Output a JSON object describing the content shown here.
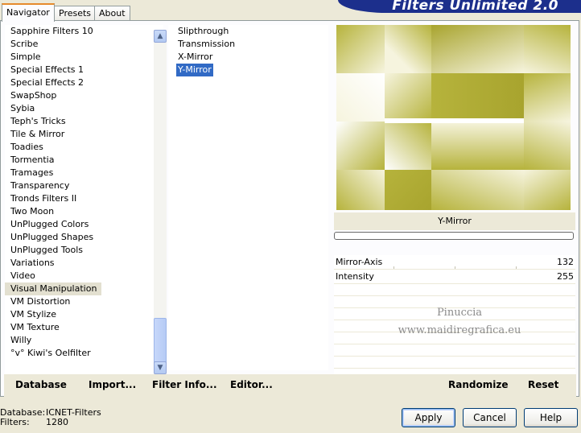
{
  "tabs": [
    "Navigator",
    "Presets",
    "About"
  ],
  "banner": "Filters Unlimited 2.0",
  "categories": {
    "items": [
      "Sapphire Filters 10",
      "Scribe",
      "Simple",
      "Special Effects 1",
      "Special Effects 2",
      "SwapShop",
      "Sybia",
      "Teph's Tricks",
      "Tile & Mirror",
      "Toadies",
      "Tormentia",
      "Tramages",
      "Transparency",
      "Tronds Filters II",
      "Two Moon",
      "UnPlugged Colors",
      "UnPlugged Shapes",
      "UnPlugged Tools",
      "Variations",
      "Video",
      "Visual Manipulation",
      "VM Distortion",
      "VM Stylize",
      "VM Texture",
      "Willy",
      "°v° Kiwi's Oelfilter"
    ],
    "selected": "Visual Manipulation",
    "scroll_up": "▲",
    "scroll_down": "▼"
  },
  "filters": {
    "items": [
      "Slipthrough",
      "Transmission",
      "X-Mirror",
      "Y-Mirror"
    ],
    "selected": "Y-Mirror"
  },
  "preview": {
    "filter_name": "Y-Mirror",
    "colors": {
      "olive": "#b6b33c",
      "light": "#f6f4de",
      "white": "#ffffff",
      "dark": "#a8a42e"
    }
  },
  "controls": [
    {
      "label": "Mirror-Axis",
      "value": "132"
    },
    {
      "label": "Intensity",
      "value": "255"
    }
  ],
  "watermark": {
    "line1": "Pinuccia",
    "line2": "www.maidiregrafica.eu"
  },
  "buttons": {
    "database": "Database",
    "import": "Import...",
    "filter_info": "Filter Info...",
    "editor": "Editor...",
    "randomize": "Randomize",
    "reset": "Reset",
    "apply": "Apply",
    "cancel": "Cancel",
    "help": "Help"
  },
  "info": {
    "database_label": "Database:",
    "database_value": "ICNET-Filters",
    "filters_label": "Filters:",
    "filters_value": "1280"
  },
  "colors": {
    "selection": "#316ac5",
    "banner": "#1c2f8c",
    "tab_highlight": "#e68b2c"
  }
}
